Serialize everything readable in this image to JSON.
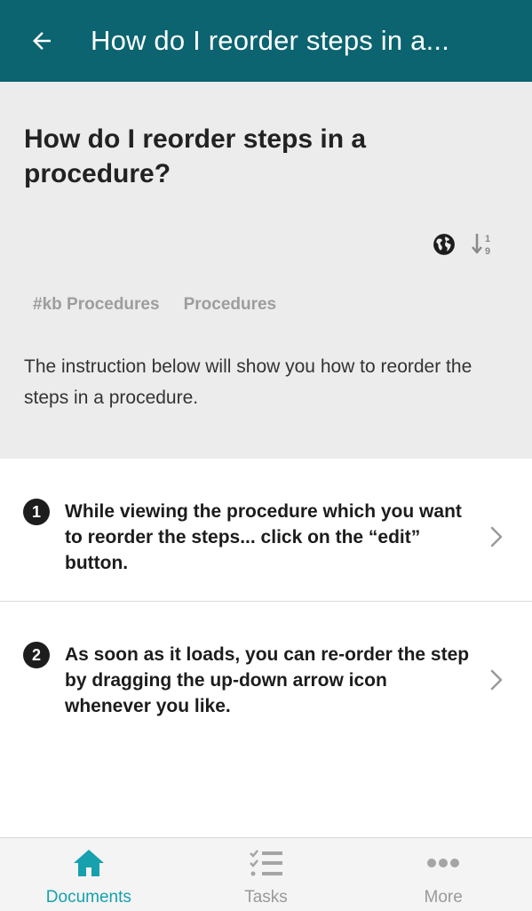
{
  "appbar": {
    "title": "How do I reorder steps in a...",
    "back_icon": "arrow-left-icon"
  },
  "document": {
    "title": "How do I reorder steps in a procedure?",
    "icons": [
      "globe-icon",
      "sort-numeric-icon"
    ],
    "tags": [
      "#kb Procedures",
      "Procedures"
    ],
    "description": "The instruction below will show you how to reorder the steps in a procedure."
  },
  "steps": [
    {
      "number": "1",
      "text": "While viewing the procedure which you want to reorder the steps... click on the “edit” button."
    },
    {
      "number": "2",
      "text": "As soon as it loads, you can re-order the step by dragging the up-down arrow icon whenever you like."
    }
  ],
  "tabbar": {
    "tabs": [
      {
        "label": "Documents",
        "icon": "home-icon",
        "active": true
      },
      {
        "label": "Tasks",
        "icon": "checklist-icon",
        "active": false
      },
      {
        "label": "More",
        "icon": "more-dots-icon",
        "active": false
      }
    ]
  },
  "colors": {
    "appbar": "#0b6470",
    "accent": "#17a0ad",
    "header_bg": "#ececec",
    "muted": "#9a9a9a"
  }
}
